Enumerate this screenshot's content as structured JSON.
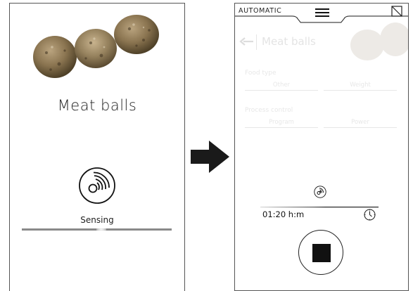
{
  "left_screen": {
    "title": "Meat balls",
    "status": "Sensing",
    "progress": 0.53
  },
  "right_screen": {
    "mode": "AUTOMATIC",
    "title": "Meat balls",
    "sections": [
      {
        "label": "Food type",
        "fields": [
          "Other",
          "Weight"
        ]
      },
      {
        "label": "Process control",
        "fields": [
          "Program",
          "Power"
        ]
      }
    ],
    "time": "01:20 h:m",
    "stop_label": "Stop"
  },
  "icons": {
    "left_sensing": "sensing-disc-icon",
    "menu": "hamburger-menu-icon",
    "expand": "expand-icon",
    "back": "back-arrow-icon",
    "small_sensing": "sensing-disc-icon",
    "clock": "clock-icon",
    "stop": "stop-icon",
    "transition": "right-arrow-icon"
  },
  "colors": {
    "text": "#1a1a1a",
    "frame": "#555555",
    "progress_track": "#8a8a8a",
    "stop_square": "#111111"
  }
}
